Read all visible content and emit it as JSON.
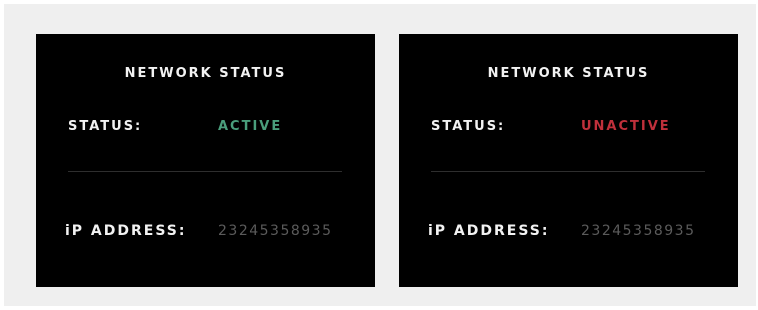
{
  "colors": {
    "background": "#efefef",
    "panel": "#000000",
    "active": "#4a9e7c",
    "inactive": "#c0303b",
    "muted": "#5b5b5b",
    "text": "#f2f2f2",
    "divider": "#2e2e2e"
  },
  "panels": [
    {
      "title": "NETWORK STATUS",
      "status_label": "STATUS:",
      "status_value": "ACTIVE",
      "status_color": "#4a9e7c",
      "ip_label": "iP ADDRESS:",
      "ip_value": "23245358935"
    },
    {
      "title": "NETWORK STATUS",
      "status_label": "STATUS:",
      "status_value": "UNACTIVE",
      "status_color": "#c0303b",
      "ip_label": "iP ADDRESS:",
      "ip_value": "23245358935"
    }
  ]
}
